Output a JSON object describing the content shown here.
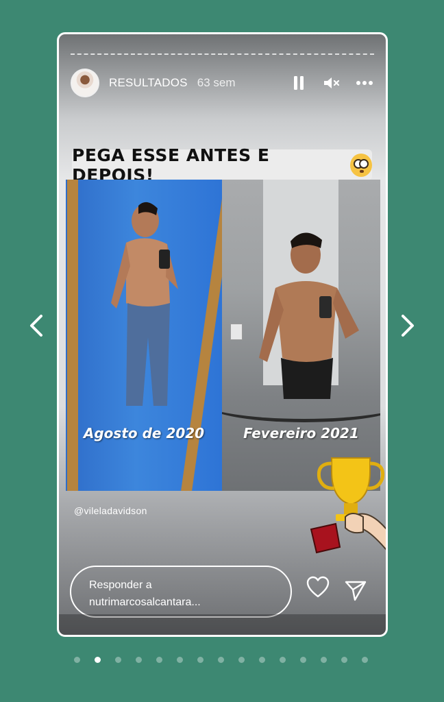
{
  "viewer": {
    "prev_icon": "chevron-left-icon",
    "next_icon": "chevron-right-icon",
    "accent_background": "#3d8872"
  },
  "story": {
    "progress_segments": 2,
    "progress_done": 0,
    "header": {
      "username": "RESULTADOS",
      "timestamp": "63 sem",
      "icons": [
        "pause-icon",
        "mute-icon",
        "more-icon"
      ]
    },
    "sticker_text": "PEGA ESSE ANTES E DEPOIS!",
    "sticker_emoji": "flushed-face-emoji",
    "photos": {
      "before_caption": "Agosto de 2020",
      "after_caption": "Fevereiro 2021"
    },
    "credit": "@vileladavidson",
    "reply": {
      "line1": "Responder a",
      "line2": "nutrimarcosalcantara..."
    },
    "actions": [
      "heart-icon",
      "send-icon"
    ]
  },
  "pagination": {
    "count": 15,
    "active_index": 1
  }
}
